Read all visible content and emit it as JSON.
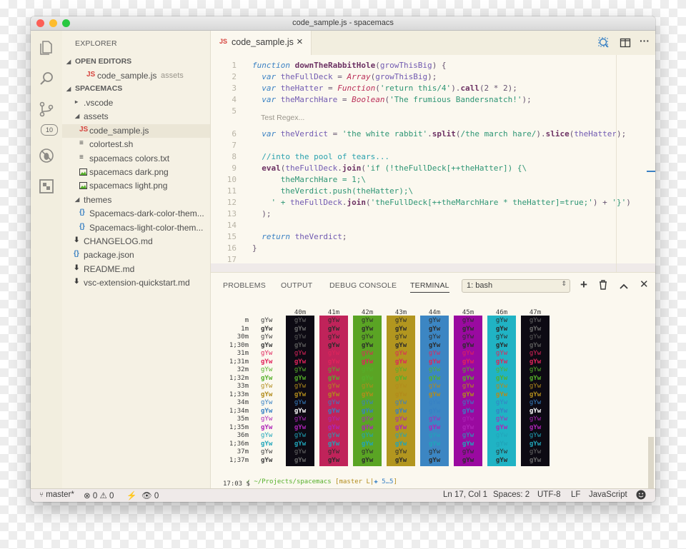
{
  "window": {
    "title": "code_sample.js - spacemacs"
  },
  "sidebar": {
    "heading": "EXPLORER",
    "open_editors_label": "OPEN EDITORS",
    "open_editor": {
      "icon": "JS",
      "name": "code_sample.js",
      "folder": "assets"
    },
    "project_label": "SPACEMACS",
    "tree": [
      {
        "kind": "folder",
        "name": ".vscode",
        "expanded": false,
        "depth": 1
      },
      {
        "kind": "folder",
        "name": "assets",
        "expanded": true,
        "depth": 1
      },
      {
        "kind": "file",
        "icon": "JS",
        "name": "code_sample.js",
        "depth": 2,
        "selected": true
      },
      {
        "kind": "file",
        "icon": "≡",
        "name": "colortest.sh",
        "depth": 2
      },
      {
        "kind": "file",
        "icon": "≡",
        "name": "spacemacs colors.txt",
        "depth": 2
      },
      {
        "kind": "file",
        "icon": "img",
        "name": "spacemacs dark.png",
        "depth": 2
      },
      {
        "kind": "file",
        "icon": "img",
        "name": "spacemacs light.png",
        "depth": 2
      },
      {
        "kind": "folder",
        "name": "themes",
        "expanded": true,
        "depth": 1
      },
      {
        "kind": "file",
        "icon": "{}",
        "name": "Spacemacs-dark-color-them...",
        "depth": 2
      },
      {
        "kind": "file",
        "icon": "{}",
        "name": "Spacemacs-light-color-them...",
        "depth": 2
      },
      {
        "kind": "file",
        "icon": "⬇",
        "name": "CHANGELOG.md",
        "depth": 1
      },
      {
        "kind": "file",
        "icon": "{}",
        "name": "package.json",
        "depth": 1
      },
      {
        "kind": "file",
        "icon": "⬇",
        "name": "README.md",
        "depth": 1
      },
      {
        "kind": "file",
        "icon": "⬇",
        "name": "vsc-extension-quickstart.md",
        "depth": 1
      }
    ]
  },
  "activity": {
    "scm_badge": "10"
  },
  "editor": {
    "tab": {
      "icon": "JS",
      "name": "code_sample.js",
      "close": "×"
    },
    "codelens": "Test Regex...",
    "lines": [
      [
        [
          "kw",
          "function "
        ],
        [
          "fn",
          "downTheRabbitHole"
        ],
        [
          "pu",
          "("
        ],
        [
          "vr",
          "growThisBig"
        ],
        [
          "pu",
          ") {"
        ]
      ],
      [
        [
          "pu",
          "  "
        ],
        [
          "kw",
          "var "
        ],
        [
          "vr",
          "theFullDeck"
        ],
        [
          "pu",
          " = "
        ],
        [
          "ty",
          "Array"
        ],
        [
          "pu",
          "("
        ],
        [
          "vr",
          "growThisBig"
        ],
        [
          "pu",
          ");"
        ]
      ],
      [
        [
          "pu",
          "  "
        ],
        [
          "kw",
          "var "
        ],
        [
          "vr",
          "theHatter"
        ],
        [
          "pu",
          " = "
        ],
        [
          "ty",
          "Function"
        ],
        [
          "pu",
          "("
        ],
        [
          "st",
          "'return this/4'"
        ],
        [
          "pu",
          ")."
        ],
        [
          "fn",
          "call"
        ],
        [
          "pu",
          "(2 * 2);"
        ]
      ],
      [
        [
          "pu",
          "  "
        ],
        [
          "kw",
          "var "
        ],
        [
          "vr",
          "theMarchHare"
        ],
        [
          "pu",
          " = "
        ],
        [
          "ty",
          "Boolean"
        ],
        [
          "pu",
          "("
        ],
        [
          "st",
          "'The frumious Bandersnatch!'"
        ],
        [
          "pu",
          ");"
        ]
      ],
      [],
      [
        [
          "pu",
          "  "
        ],
        [
          "kw",
          "var "
        ],
        [
          "vr",
          "theVerdict"
        ],
        [
          "pu",
          " = "
        ],
        [
          "st",
          "'the white rabbit'"
        ],
        [
          "pu",
          "."
        ],
        [
          "fn",
          "split"
        ],
        [
          "pu",
          "("
        ],
        [
          "st",
          "/the march hare/"
        ],
        [
          "pu",
          ")."
        ],
        [
          "fn",
          "slice"
        ],
        [
          "pu",
          "("
        ],
        [
          "vr",
          "theHatter"
        ],
        [
          "pu",
          ");"
        ]
      ],
      [],
      [
        [
          "pu",
          "  "
        ],
        [
          "cm",
          "//into the pool of tears..."
        ]
      ],
      [
        [
          "pu",
          "  "
        ],
        [
          "fn",
          "eval"
        ],
        [
          "pu",
          "("
        ],
        [
          "vr",
          "theFullDeck"
        ],
        [
          "pu",
          "."
        ],
        [
          "fn",
          "join"
        ],
        [
          "pu",
          "("
        ],
        [
          "st",
          "'if (!theFullDeck[++theHatter]) {\\"
        ]
      ],
      [
        [
          "st",
          "      theMarchHare = 1;\\"
        ]
      ],
      [
        [
          "st",
          "      theVerdict.push(theHatter);\\"
        ]
      ],
      [
        [
          "st",
          "    ' + "
        ],
        [
          "vr",
          "theFullDeck"
        ],
        [
          "pu",
          "."
        ],
        [
          "fn",
          "join"
        ],
        [
          "pu",
          "("
        ],
        [
          "st",
          "'theFullDeck[++theMarchHare * theHatter]=true;'"
        ],
        [
          "pu",
          ") + "
        ],
        [
          "st",
          "'}'"
        ],
        [
          "pu",
          ")"
        ]
      ],
      [
        [
          "pu",
          "  );"
        ]
      ],
      [],
      [
        [
          "pu",
          "  "
        ],
        [
          "kw",
          "return "
        ],
        [
          "vr",
          "theVerdict"
        ],
        [
          "pu",
          ";"
        ]
      ],
      [
        [
          "pu",
          "}"
        ]
      ],
      []
    ]
  },
  "panel": {
    "tabs": [
      "PROBLEMS",
      "OUTPUT",
      "DEBUG CONSOLE",
      "TERMINAL"
    ],
    "active_tab": "TERMINAL",
    "shell_select": "1: bash"
  },
  "terminal": {
    "bg_labels": [
      "40m",
      "41m",
      "42m",
      "43m",
      "44m",
      "45m",
      "46m",
      "47m"
    ],
    "bg_colors": [
      "#0d0a13",
      "#c0235a",
      "#5aa424",
      "#b2961f",
      "#3c86c3",
      "#9a0aa0",
      "#20b3c4",
      "#0d0a13"
    ],
    "rows": [
      {
        "label": "m",
        "fg": "#3c3c3c",
        "bold": false
      },
      {
        "label": "1m",
        "fg": "#3c3c3c",
        "bold": true
      },
      {
        "label": "30m",
        "fg": "#3c3c3c",
        "bold": false
      },
      {
        "label": "1;30m",
        "fg": "#3c3c3c",
        "bold": true
      },
      {
        "label": "31m",
        "fg": "#e0245c",
        "bold": false
      },
      {
        "label": "1;31m",
        "fg": "#e0245c",
        "bold": true
      },
      {
        "label": "32m",
        "fg": "#55b02a",
        "bold": false
      },
      {
        "label": "1;32m",
        "fg": "#55b02a",
        "bold": true
      },
      {
        "label": "33m",
        "fg": "#b28c1c",
        "bold": false
      },
      {
        "label": "1;33m",
        "fg": "#b28c1c",
        "bold": true
      },
      {
        "label": "34m",
        "fg": "#3780c4",
        "bold": false
      },
      {
        "label": "1;34m",
        "fg": "#3780c4",
        "bold": true
      },
      {
        "label": "35m",
        "fg": "#ae24b8",
        "bold": false
      },
      {
        "label": "1;35m",
        "fg": "#ae24b8",
        "bold": true
      },
      {
        "label": "36m",
        "fg": "#20a5ba",
        "bold": false
      },
      {
        "label": "1;36m",
        "fg": "#20a5ba",
        "bold": true
      },
      {
        "label": "37m",
        "fg": "#3c3c3c",
        "bold": false
      },
      {
        "label": "1;37m",
        "fg": "#3c3c3c",
        "bold": true
      }
    ],
    "sample": "gYw",
    "prompt_path": "✓ ~/Projects/spacemacs",
    "prompt_git": " [master L|",
    "prompt_git2": "✚ 5…5",
    "prompt_git_end": "]",
    "prompt_line2": "17:03 $"
  },
  "status": {
    "branch": "master*",
    "errors": "0",
    "warnings": "0",
    "live_share": "0",
    "position": "Ln 17, Col 1",
    "spaces": "Spaces: 2",
    "encoding": "UTF-8",
    "eol": "LF",
    "language": "JavaScript"
  }
}
